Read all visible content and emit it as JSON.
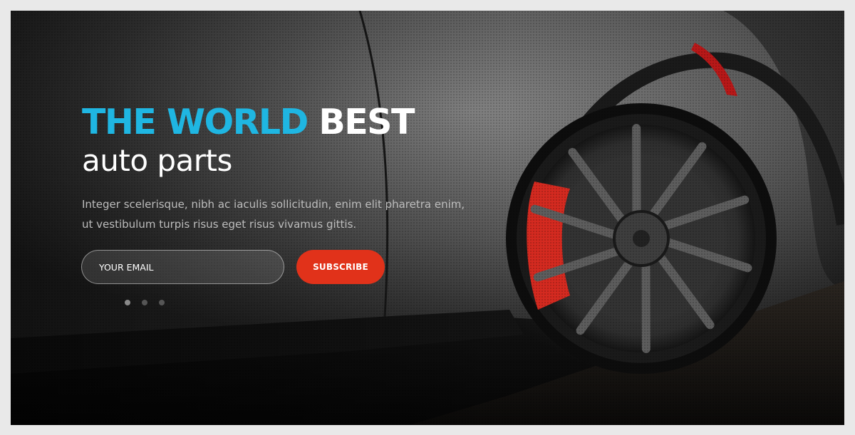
{
  "hero": {
    "headline_accent": "THE WORLD",
    "headline_white": "BEST",
    "subheadline": "auto parts",
    "description": "Integer scelerisque, nibh ac iaculis sollicitudin, enim elit pharetra enim, ut vestibulum turpis risus eget risus vivamus gittis.",
    "email_placeholder": "YOUR EMAIL",
    "subscribe_label": "SUBSCRIBE",
    "slide_count": 3,
    "active_slide": 1
  },
  "colors": {
    "accent": "#1fb6e2",
    "button": "#e1321a",
    "caliper": "#d42a20"
  }
}
